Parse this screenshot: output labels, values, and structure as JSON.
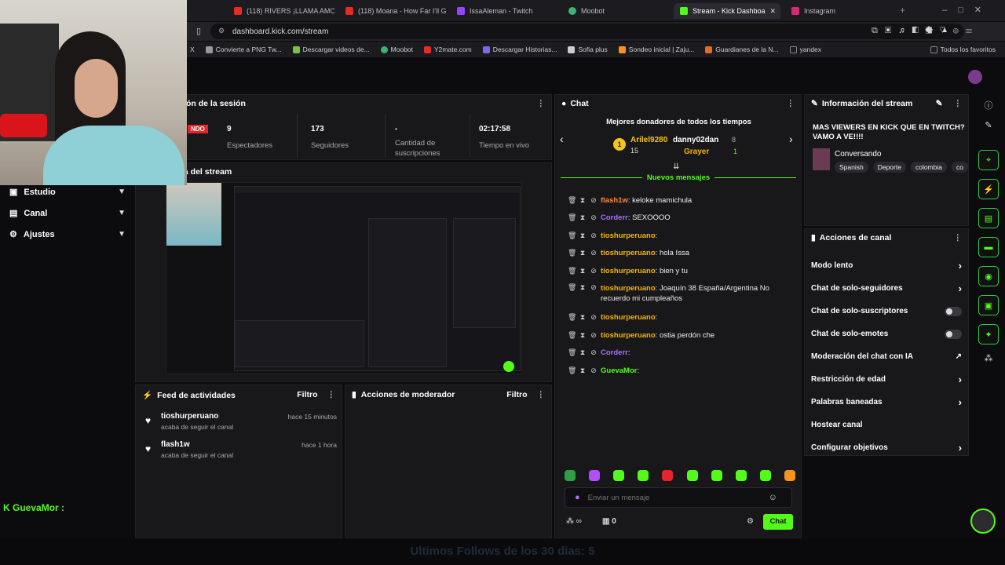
{
  "tabs": [
    {
      "label": "(118) RIVERS ¡LLAMA AMO",
      "color": "#e52d27"
    },
    {
      "label": "(118) Moana - How Far I'll Go",
      "color": "#e52d27"
    },
    {
      "label": "IssaAleman - Twitch",
      "color": "#9146ff"
    },
    {
      "label": "Moobot",
      "color": "#3bb371"
    },
    {
      "label": "Stream - Kick Dashboa",
      "color": "#53fc18"
    },
    {
      "label": "Instagram",
      "color": "#d62976"
    }
  ],
  "url": "dashboard.kick.com/stream",
  "bookmarks": [
    {
      "label": "X",
      "color": "#777"
    },
    {
      "label": "Convierte a PNG Tw...",
      "color": "#999"
    },
    {
      "label": "Descargar videos de...",
      "color": "#7cc242"
    },
    {
      "label": "Moobot",
      "color": "#3bb371"
    },
    {
      "label": "Y2mate.com",
      "color": "#e52d27"
    },
    {
      "label": "Descargar Historias...",
      "color": "#7b68ee"
    },
    {
      "label": "Sofia plus",
      "color": "#ccc"
    },
    {
      "label": "Sondeo inicial | Zaju...",
      "color": "#f7941d"
    },
    {
      "label": "Guardianes de la N...",
      "color": "#e56b1f"
    },
    {
      "label": "yandex",
      "color": "#888"
    }
  ],
  "bookmarks_all": "Todos los favoritos",
  "session": {
    "title": "ón de la sesión",
    "live_badge": "NDO",
    "stats": [
      {
        "value": "9",
        "label": "Espectadores"
      },
      {
        "value": "173",
        "label": "Seguidores"
      },
      {
        "value": "-",
        "label": "Cantidad de suscripciones"
      },
      {
        "value": "02:17:58",
        "label": "Tiempo en vivo"
      }
    ]
  },
  "preview_title": "ia del stream",
  "sidebar": [
    {
      "label": "Estudio"
    },
    {
      "label": "Canal"
    },
    {
      "label": "Ajustes"
    }
  ],
  "activity": {
    "title": "Feed de actividades",
    "filter": "Filtro",
    "items": [
      {
        "user": "tioshurperuano",
        "text": "acaba de seguir el canal",
        "time": "hace 15 minutos"
      },
      {
        "user": "flash1w",
        "text": "acaba de seguir el canal",
        "time": "hace 1 hora"
      }
    ]
  },
  "modactions": {
    "title": "Acciones de moderador",
    "filter": "Filtro"
  },
  "chat": {
    "title": "Chat",
    "donors_title": "Mejores donadores de todos los tiempos",
    "donors": [
      {
        "name": "Arilel9280",
        "amount": "15",
        "rank": "1"
      },
      {
        "name": "danny02dan",
        "amount": "8",
        "rank": ""
      },
      {
        "name": "Grayer",
        "amount": "1",
        "rank": ""
      }
    ],
    "new_messages": "Nuevos mensajes",
    "messages": [
      {
        "user": "flash1w",
        "text": ": keloke mamichula",
        "color": "#ff8a3d"
      },
      {
        "user": "Corderr",
        "text": ": SEXOOOO",
        "color": "#a970ff"
      },
      {
        "user": "tioshurperuano",
        "text": ":",
        "color": "#f7b500"
      },
      {
        "user": "tioshurperuano",
        "text": ": hola Issa",
        "color": "#f7b500"
      },
      {
        "user": "tioshurperuano",
        "text": ": bien y tu",
        "color": "#f7b500"
      },
      {
        "user": "tioshurperuano",
        "text": ": Joaquín 38 España/Argentina No recuerdo mi cumpleaños",
        "color": "#f7b500"
      },
      {
        "user": "tioshurperuano",
        "text": ":",
        "color": "#f7b500"
      },
      {
        "user": "tioshurperuano",
        "text": ": ostia perdón che",
        "color": "#f7b500"
      },
      {
        "user": "Corderr",
        "text": ":",
        "color": "#a970ff"
      },
      {
        "user": "GuevaMor",
        "text": ":",
        "color": "#53fc18"
      }
    ],
    "input_placeholder": "Enviar un mensaje",
    "count": "0",
    "send_label": "Chat"
  },
  "stream_info": {
    "title": "Información del stream",
    "stream_title": "MAS VIEWERS EN KICK QUE EN TWITCH? VAMO A VE!!!!",
    "category": "Conversando",
    "tags": [
      "Spanish",
      "Deporte",
      "colombia",
      "co"
    ]
  },
  "channel_actions": {
    "title": "Acciones de canal",
    "items": [
      {
        "label": "Modo lento",
        "control": "chevron"
      },
      {
        "label": "Chat de solo-seguidores",
        "control": "chevron"
      },
      {
        "label": "Chat de solo-suscriptores",
        "control": "toggle"
      },
      {
        "label": "Chat de solo-emotes",
        "control": "toggle"
      },
      {
        "label": "Moderación del chat con IA",
        "control": "external"
      },
      {
        "label": "Restricción de edad",
        "control": "chevron"
      },
      {
        "label": "Palabras baneadas",
        "control": "chevron"
      },
      {
        "label": "Hostear canal",
        "control": "none"
      },
      {
        "label": "Configurar objetivos",
        "control": "chevron"
      }
    ]
  },
  "overlay": {
    "chat_user": "GuevaMor :",
    "follows_banner": "Ultimos Follows de los 30 dias: 5"
  },
  "accent": "#53fc18"
}
